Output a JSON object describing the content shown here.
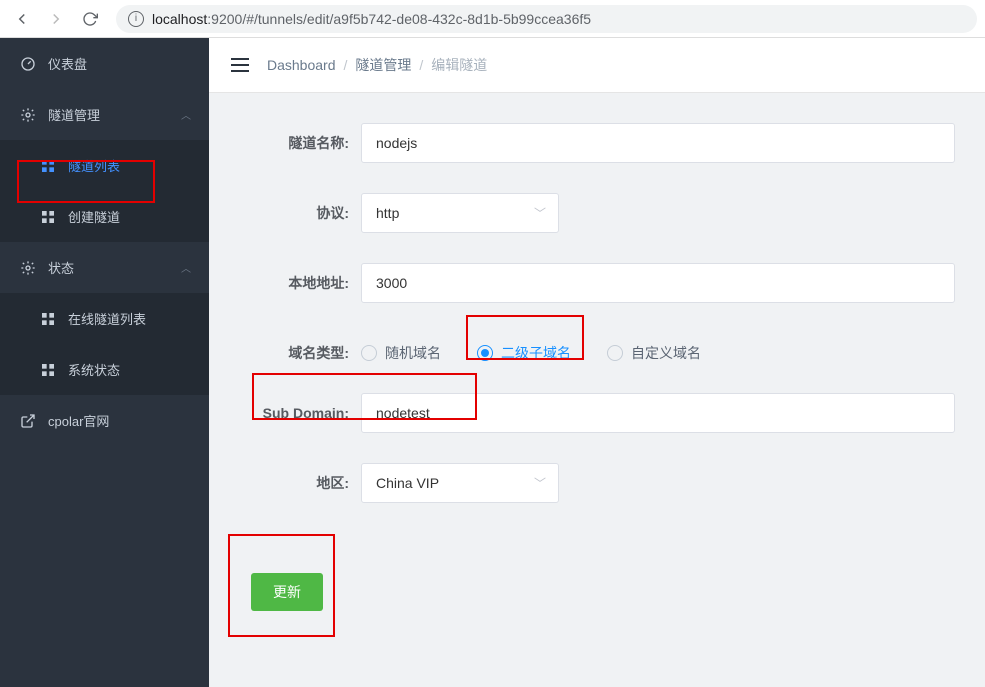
{
  "browser": {
    "url_host": "localhost",
    "url_port": ":9200",
    "url_path": "/#/tunnels/edit/a9f5b742-de08-432c-8d1b-5b99ccea36f5"
  },
  "sidebar": {
    "dashboard": "仪表盘",
    "tunnel_mgmt": "隧道管理",
    "tunnel_list": "隧道列表",
    "tunnel_create": "创建隧道",
    "status": "状态",
    "online_list": "在线隧道列表",
    "sys_status": "系统状态",
    "cpolar_site": "cpolar官网"
  },
  "breadcrumb": {
    "a": "Dashboard",
    "b": "隧道管理",
    "c": "编辑隧道"
  },
  "form": {
    "name_label": "隧道名称:",
    "name_value": "nodejs",
    "proto_label": "协议:",
    "proto_value": "http",
    "addr_label": "本地地址:",
    "addr_value": "3000",
    "domain_type_label": "域名类型:",
    "domain_opts": {
      "random": "随机域名",
      "subdomain": "二级子域名",
      "custom": "自定义域名"
    },
    "subdomain_label": "Sub Domain:",
    "subdomain_value": "nodetest",
    "region_label": "地区:",
    "region_value": "China VIP",
    "submit": "更新"
  }
}
